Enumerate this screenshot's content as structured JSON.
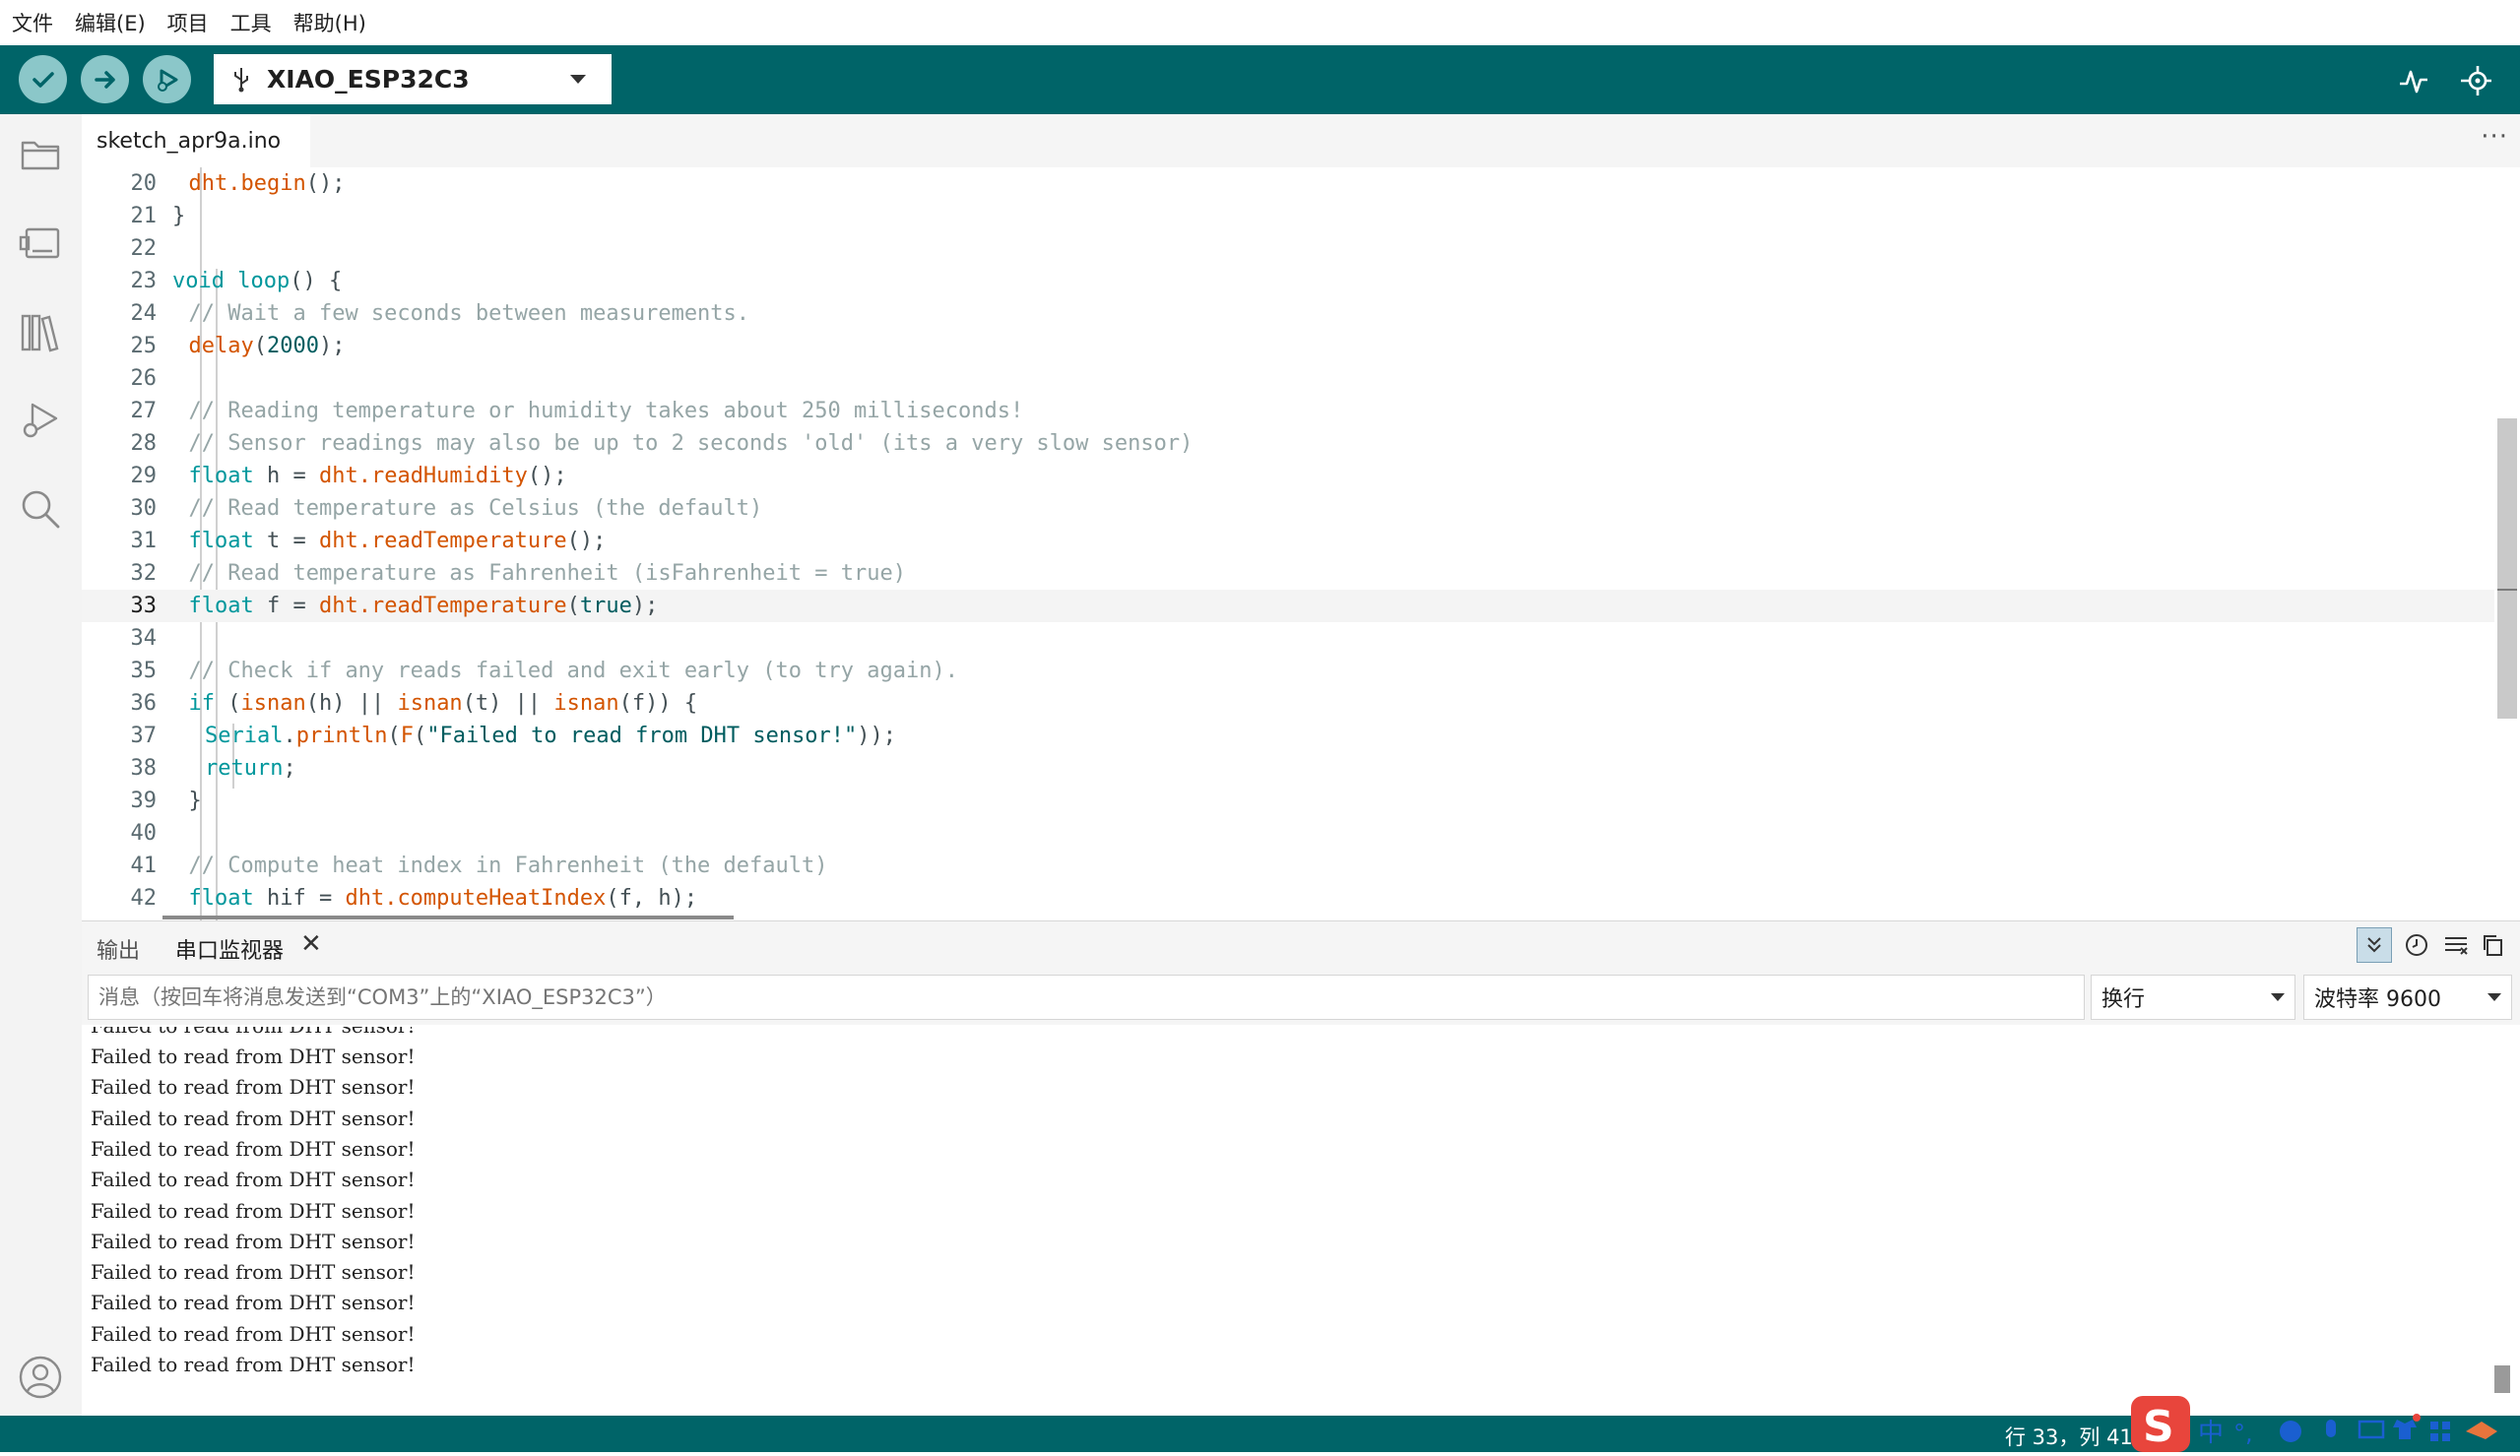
{
  "menu": [
    "文件",
    "编辑(E)",
    "项目",
    "工具",
    "帮助(H)"
  ],
  "toolbar": {
    "board": "XIAO_ESP32C3",
    "colors": {
      "bar": "#006468",
      "button": "#8bc7c9"
    },
    "icons": [
      "verify-check-icon",
      "upload-arrow-icon",
      "debug-icon",
      "usb-icon",
      "serial-plotter-icon",
      "serial-monitor-icon"
    ]
  },
  "sidebar": {
    "icons": [
      "folder-icon",
      "board-manager-icon",
      "library-icon",
      "debug-run-icon",
      "search-icon",
      "account-icon"
    ]
  },
  "tab": {
    "filename": "sketch_apr9a.ino",
    "more": "···"
  },
  "editor": {
    "active_line": 33,
    "lines": [
      {
        "n": "20",
        "indent": 1,
        "segs": [
          [
            "dht.",
            "fn"
          ],
          [
            "begin",
            "fn"
          ],
          [
            "();",
            ""
          ]
        ]
      },
      {
        "n": "21",
        "indent": 0,
        "segs": [
          [
            "}",
            ""
          ]
        ]
      },
      {
        "n": "22",
        "indent": 0,
        "segs": []
      },
      {
        "n": "23",
        "indent": 0,
        "segs": [
          [
            "void",
            "kw"
          ],
          [
            " ",
            ""
          ],
          [
            "loop",
            "kw"
          ],
          [
            "() {",
            ""
          ]
        ]
      },
      {
        "n": "24",
        "indent": 1,
        "segs": [
          [
            "// Wait a few seconds between measurements.",
            "cm"
          ]
        ]
      },
      {
        "n": "25",
        "indent": 1,
        "segs": [
          [
            "delay",
            "fn"
          ],
          [
            "(",
            ""
          ],
          [
            "2000",
            "num"
          ],
          [
            ");",
            ""
          ]
        ]
      },
      {
        "n": "26",
        "indent": 0,
        "segs": []
      },
      {
        "n": "27",
        "indent": 1,
        "segs": [
          [
            "// Reading temperature or humidity takes about 250 milliseconds!",
            "cm"
          ]
        ]
      },
      {
        "n": "28",
        "indent": 1,
        "segs": [
          [
            "// Sensor readings may also be up to 2 seconds 'old' (its a very slow sensor)",
            "cm"
          ]
        ]
      },
      {
        "n": "29",
        "indent": 1,
        "segs": [
          [
            "float",
            "kw"
          ],
          [
            " h = ",
            ""
          ],
          [
            "dht.",
            "fn"
          ],
          [
            "readHumidity",
            "fn"
          ],
          [
            "();",
            ""
          ]
        ]
      },
      {
        "n": "30",
        "indent": 1,
        "segs": [
          [
            "// Read temperature as Celsius (the default)",
            "cm"
          ]
        ]
      },
      {
        "n": "31",
        "indent": 1,
        "segs": [
          [
            "float",
            "kw"
          ],
          [
            " t = ",
            ""
          ],
          [
            "dht.",
            "fn"
          ],
          [
            "readTemperature",
            "fn"
          ],
          [
            "();",
            ""
          ]
        ]
      },
      {
        "n": "32",
        "indent": 1,
        "segs": [
          [
            "// Read temperature as Fahrenheit (isFahrenheit = true)",
            "cm"
          ]
        ]
      },
      {
        "n": "33",
        "indent": 1,
        "segs": [
          [
            "float",
            "kw"
          ],
          [
            " f = ",
            ""
          ],
          [
            "dht.",
            "fn"
          ],
          [
            "readTemperature",
            "fn"
          ],
          [
            "(",
            ""
          ],
          [
            "true",
            "num"
          ],
          [
            ");",
            ""
          ]
        ]
      },
      {
        "n": "34",
        "indent": 0,
        "segs": []
      },
      {
        "n": "35",
        "indent": 1,
        "segs": [
          [
            "// Check if any reads failed and exit early (to try again).",
            "cm"
          ]
        ]
      },
      {
        "n": "36",
        "indent": 1,
        "segs": [
          [
            "if",
            "kw"
          ],
          [
            " (",
            ""
          ],
          [
            "isnan",
            "fn"
          ],
          [
            "(h) || ",
            ""
          ],
          [
            "isnan",
            "fn"
          ],
          [
            "(t) || ",
            ""
          ],
          [
            "isnan",
            "fn"
          ],
          [
            "(f)) {",
            ""
          ]
        ]
      },
      {
        "n": "37",
        "indent": 2,
        "segs": [
          [
            "Serial",
            "kw"
          ],
          [
            ".",
            ""
          ],
          [
            "println",
            "fn"
          ],
          [
            "(",
            ""
          ],
          [
            "F",
            "fn"
          ],
          [
            "(",
            ""
          ],
          [
            "\"Failed to read from DHT sensor!\"",
            "str"
          ],
          [
            "));",
            ""
          ]
        ]
      },
      {
        "n": "38",
        "indent": 2,
        "segs": [
          [
            "return",
            "kw"
          ],
          [
            ";",
            ""
          ]
        ]
      },
      {
        "n": "39",
        "indent": 1,
        "segs": [
          [
            "}",
            ""
          ]
        ]
      },
      {
        "n": "40",
        "indent": 0,
        "segs": []
      },
      {
        "n": "41",
        "indent": 1,
        "segs": [
          [
            "// Compute heat index in Fahrenheit (the default)",
            "cm"
          ]
        ]
      },
      {
        "n": "42",
        "indent": 1,
        "segs": [
          [
            "float",
            "kw"
          ],
          [
            " hif = ",
            ""
          ],
          [
            "dht.",
            "fn"
          ],
          [
            "computeHeatIndex",
            "fn"
          ],
          [
            "(f, h);",
            ""
          ]
        ]
      }
    ]
  },
  "panel": {
    "tab_output": "输出",
    "tab_serial": "串口监视器",
    "close": "✕",
    "message_placeholder": "消息（按回车将消息发送到“COM3”上的“XIAO_ESP32C3”）",
    "line_ending": "换行",
    "baud": "波特率 9600"
  },
  "serial_output": [
    "Failed to read from DHT sensor!",
    "Failed to read from DHT sensor!",
    "Failed to read from DHT sensor!",
    "Failed to read from DHT sensor!",
    "Failed to read from DHT sensor!",
    "Failed to read from DHT sensor!",
    "Failed to read from DHT sensor!",
    "Failed to read from DHT sensor!",
    "Failed to read from DHT sensor!",
    "Failed to read from DHT sensor!",
    "Failed to read from DHT sensor!",
    "Failed to read from DHT sensor!"
  ],
  "status": {
    "cursor": "行 33，列 41"
  },
  "ime": {
    "logo": "S",
    "mode": "中",
    "punct": "°,"
  }
}
